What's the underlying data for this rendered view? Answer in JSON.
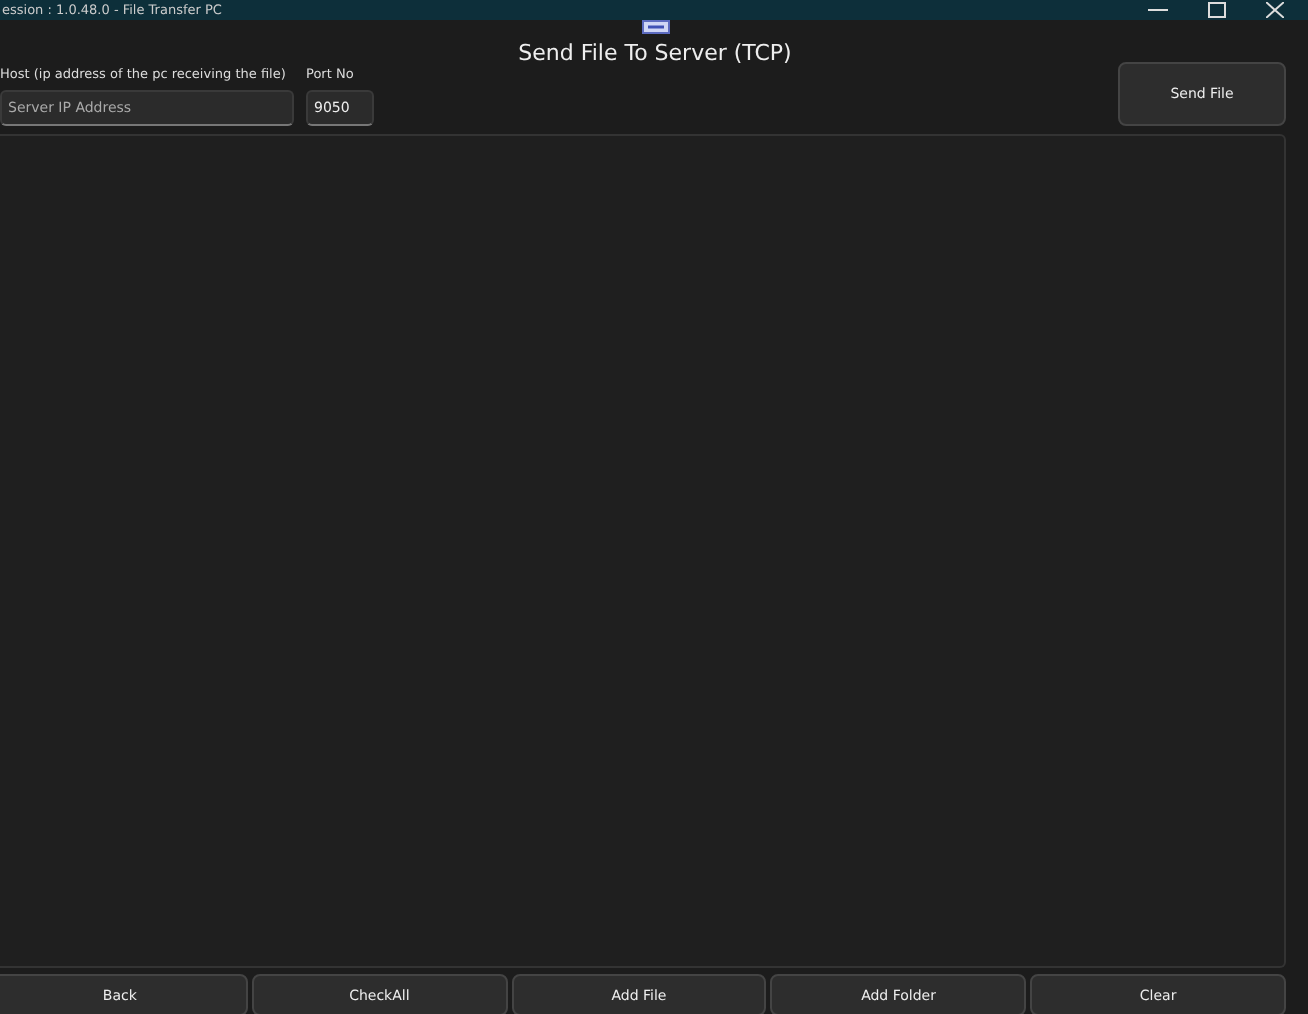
{
  "window": {
    "title": "ession : 1.0.48.0 - File Transfer PC"
  },
  "heading": "Send File To Server (TCP)",
  "host": {
    "label": "Host (ip address of the pc receiving the file)",
    "placeholder": "Server IP Address"
  },
  "port": {
    "label": "Port No",
    "value": "9050"
  },
  "send_button": "Send File",
  "buttons": [
    "Back",
    "CheckAll",
    "Add File",
    "Add Folder",
    "Clear"
  ]
}
